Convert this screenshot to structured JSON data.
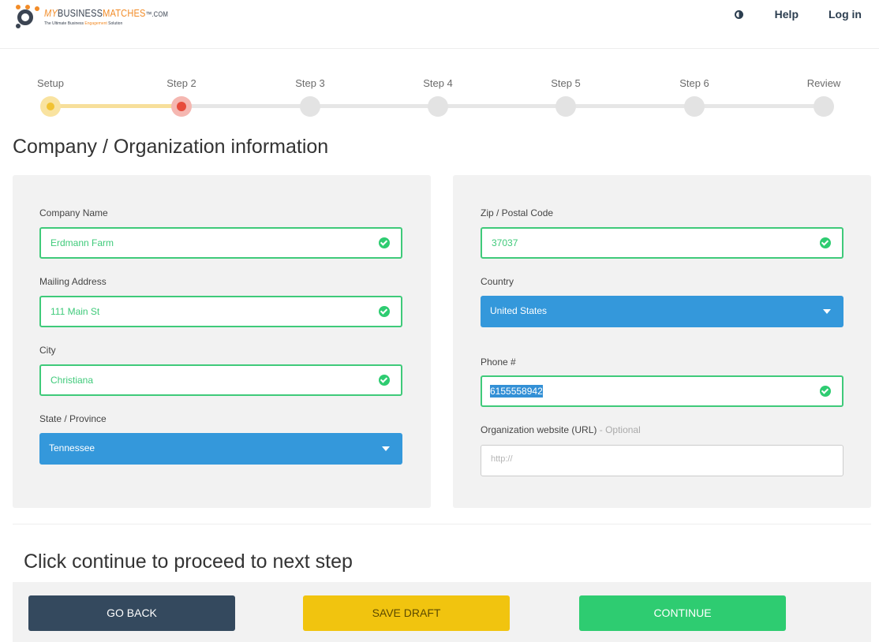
{
  "header": {
    "logo": {
      "my": "MY",
      "business": "BUSINESS",
      "matches": "MATCHES",
      "com": "™.COM",
      "tagline_pre": "The Ultimate Business ",
      "tagline_hl": "Engagement",
      "tagline_post": " Solution"
    },
    "nav": {
      "contrast_icon": "contrast-icon",
      "help": "Help",
      "login": "Log in"
    }
  },
  "stepper": {
    "steps": [
      {
        "label": "Setup",
        "state": "done"
      },
      {
        "label": "Step 2",
        "state": "active"
      },
      {
        "label": "Step 3",
        "state": "pending"
      },
      {
        "label": "Step 4",
        "state": "pending"
      },
      {
        "label": "Step 5",
        "state": "pending"
      },
      {
        "label": "Step 6",
        "state": "pending"
      },
      {
        "label": "Review",
        "state": "pending"
      }
    ]
  },
  "page_title": "Company / Organization information",
  "left_panel": {
    "company_name": {
      "label": "Company Name",
      "value": "Erdmann Farm"
    },
    "mailing_address": {
      "label": "Mailing Address",
      "value": "111 Main St"
    },
    "city": {
      "label": "City",
      "value": "Christiana"
    },
    "state": {
      "label": "State / Province",
      "value": "Tennessee"
    }
  },
  "right_panel": {
    "zip": {
      "label": "Zip / Postal Code",
      "value": "37037"
    },
    "country": {
      "label": "Country",
      "value": "United States"
    },
    "phone": {
      "label": "Phone #",
      "value": "6155558942"
    },
    "website": {
      "label": "Organization website (URL)",
      "optional": " - Optional",
      "placeholder": "http://"
    }
  },
  "footer": {
    "prompt": "Click continue to proceed to next step",
    "go_back": "GO BACK",
    "save_draft": "SAVE DRAFT",
    "continue": "CONTINUE"
  },
  "colors": {
    "valid_green": "#3fca7a",
    "select_blue": "#3498db",
    "go_back": "#34495e",
    "save_draft": "#f1c40f",
    "continue": "#2ecc71"
  }
}
